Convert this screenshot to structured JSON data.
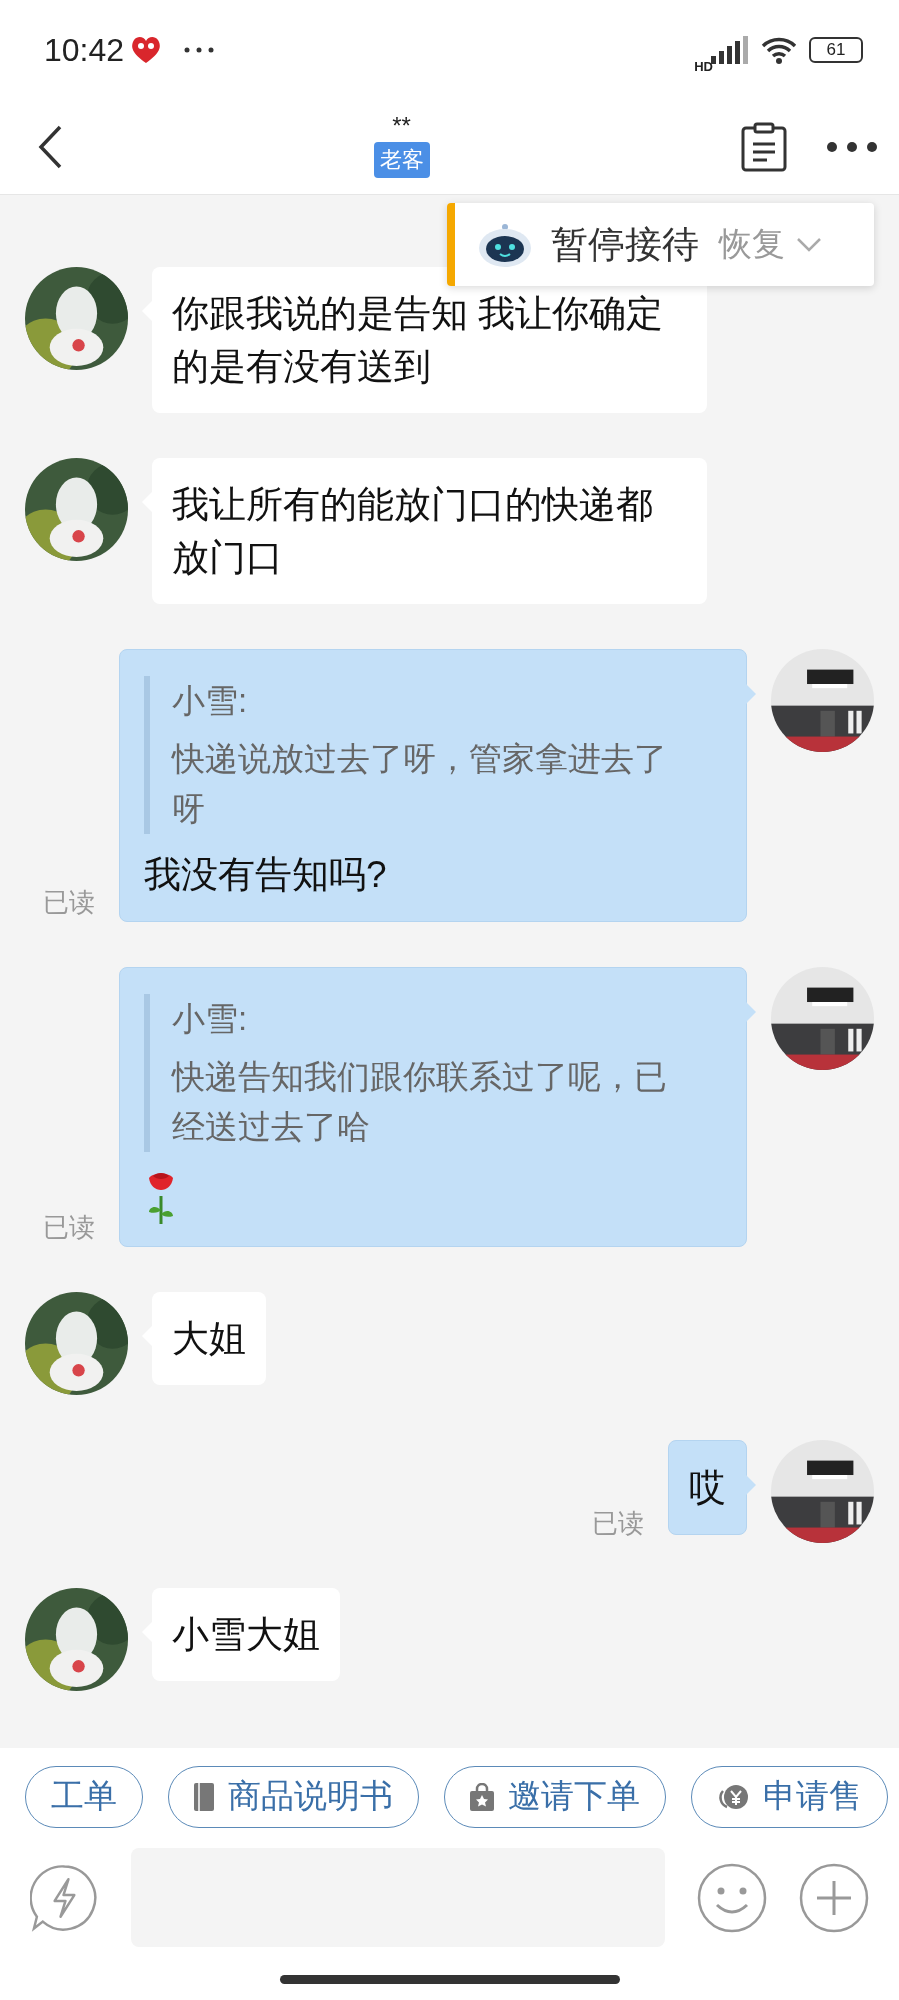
{
  "status_bar": {
    "time": "10:42",
    "network": "HD",
    "battery": "61"
  },
  "header": {
    "title": "**",
    "tag": "老客"
  },
  "pause_popup": {
    "label": "暂停接待",
    "action": "恢复"
  },
  "messages": [
    {
      "kind": "incoming",
      "text": "你跟我说的是告知 我让你确定的是有没有送到"
    },
    {
      "kind": "incoming",
      "text": "我让所有的能放门口的快递都放门口"
    },
    {
      "kind": "outgoing",
      "read": "已读",
      "quote": {
        "author": "小雪:",
        "text": "快递说放过去了呀，管家拿进去了呀"
      },
      "text": "我没有告知吗?"
    },
    {
      "kind": "outgoing",
      "read": "已读",
      "quote": {
        "author": "小雪:",
        "text": "快递告知我们跟你联系过了呢，已经送过去了哈"
      },
      "sticker": {
        "kind": "icon"
      }
    },
    {
      "kind": "incoming",
      "text": "大姐"
    },
    {
      "kind": "outgoing",
      "read": "已读",
      "text": "哎"
    },
    {
      "kind": "incoming",
      "text": "小雪大姐"
    }
  ],
  "quick_replies": [
    {
      "kind": "plain",
      "label": "工单"
    },
    {
      "kind": "book",
      "label": "商品说明书"
    },
    {
      "kind": "bag",
      "label": "邀请下单"
    },
    {
      "kind": "coin",
      "label": "申请售"
    }
  ]
}
